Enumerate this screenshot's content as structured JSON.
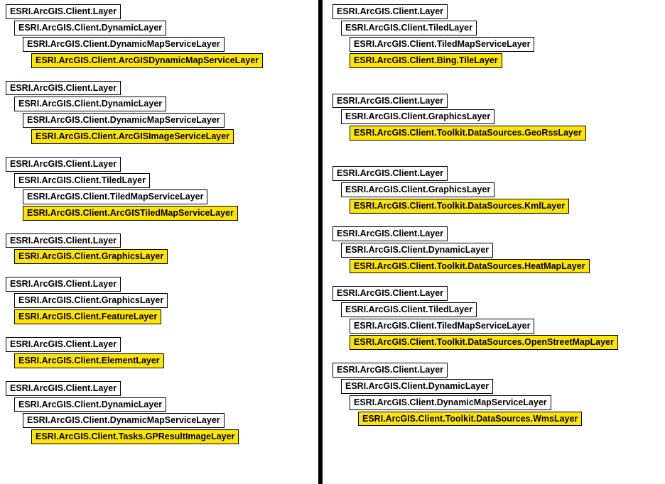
{
  "left": [
    {
      "gap": "normal",
      "nodes": [
        {
          "level": 0,
          "hl": false,
          "text": "ESRI.ArcGIS.Client.Layer"
        },
        {
          "level": 1,
          "hl": false,
          "text": "ESRI.ArcGIS.Client.DynamicLayer"
        },
        {
          "level": 2,
          "hl": false,
          "text": "ESRI.ArcGIS.Client.DynamicMapServiceLayer"
        },
        {
          "level": 3,
          "hl": true,
          "text": "ESRI.ArcGIS.Client.ArcGISDynamicMapServiceLayer"
        }
      ]
    },
    {
      "gap": "normal",
      "nodes": [
        {
          "level": 0,
          "hl": false,
          "text": "ESRI.ArcGIS.Client.Layer"
        },
        {
          "level": 1,
          "hl": false,
          "text": "ESRI.ArcGIS.Client.DynamicLayer"
        },
        {
          "level": 2,
          "hl": false,
          "text": "ESRI.ArcGIS.Client.DynamicMapServiceLayer"
        },
        {
          "level": 3,
          "hl": true,
          "text": "ESRI.ArcGIS.Client.ArcGISImageServiceLayer"
        }
      ]
    },
    {
      "gap": "normal",
      "nodes": [
        {
          "level": 0,
          "hl": false,
          "text": "ESRI.ArcGIS.Client.Layer"
        },
        {
          "level": 1,
          "hl": false,
          "text": "ESRI.ArcGIS.Client.TiledLayer"
        },
        {
          "level": 2,
          "hl": false,
          "text": "ESRI.ArcGIS.Client.TiledMapServiceLayer"
        },
        {
          "level": 2,
          "hl": true,
          "text": "ESRI.ArcGIS.Client.ArcGISTiledMapServiceLayer"
        }
      ]
    },
    {
      "gap": "normal",
      "nodes": [
        {
          "level": 0,
          "hl": false,
          "text": "ESRI.ArcGIS.Client.Layer"
        },
        {
          "level": 1,
          "hl": true,
          "text": "ESRI.ArcGIS.Client.GraphicsLayer"
        }
      ]
    },
    {
      "gap": "normal",
      "nodes": [
        {
          "level": 0,
          "hl": false,
          "text": "ESRI.ArcGIS.Client.Layer"
        },
        {
          "level": 1,
          "hl": false,
          "text": "ESRI.ArcGIS.Client.GraphicsLayer"
        },
        {
          "level": 1,
          "hl": true,
          "text": "ESRI.ArcGIS.Client.FeatureLayer"
        }
      ]
    },
    {
      "gap": "normal",
      "nodes": [
        {
          "level": 0,
          "hl": false,
          "text": "ESRI.ArcGIS.Client.Layer"
        },
        {
          "level": 1,
          "hl": true,
          "text": "ESRI.ArcGIS.Client.ElementLayer"
        }
      ]
    },
    {
      "gap": "normal",
      "nodes": [
        {
          "level": 0,
          "hl": false,
          "text": "ESRI.ArcGIS.Client.Layer"
        },
        {
          "level": 1,
          "hl": false,
          "text": "ESRI.ArcGIS.Client.DynamicLayer"
        },
        {
          "level": 2,
          "hl": false,
          "text": "ESRI.ArcGIS.Client.DynamicMapServiceLayer"
        },
        {
          "level": 3,
          "hl": true,
          "text": "ESRI.ArcGIS.Client.Tasks.GPResultImageLayer"
        }
      ]
    }
  ],
  "right": [
    {
      "gap": "large",
      "nodes": [
        {
          "level": 0,
          "hl": false,
          "text": "ESRI.ArcGIS.Client.Layer"
        },
        {
          "level": 1,
          "hl": false,
          "text": "ESRI.ArcGIS.Client.TiledLayer"
        },
        {
          "level": 2,
          "hl": false,
          "text": "ESRI.ArcGIS.Client.TiledMapServiceLayer"
        },
        {
          "level": 2,
          "hl": true,
          "text": "ESRI.ArcGIS.Client.Bing.TileLayer"
        }
      ]
    },
    {
      "gap": "large",
      "nodes": [
        {
          "level": 0,
          "hl": false,
          "text": "ESRI.ArcGIS.Client.Layer"
        },
        {
          "level": 1,
          "hl": false,
          "text": "ESRI.ArcGIS.Client.GraphicsLayer"
        },
        {
          "level": 2,
          "hl": true,
          "text": "ESRI.ArcGIS.Client.Toolkit.DataSources.GeoRssLayer"
        }
      ]
    },
    {
      "gap": "normal",
      "nodes": [
        {
          "level": 0,
          "hl": false,
          "text": "ESRI.ArcGIS.Client.Layer"
        },
        {
          "level": 1,
          "hl": false,
          "text": "ESRI.ArcGIS.Client.GraphicsLayer"
        },
        {
          "level": 2,
          "hl": true,
          "text": "ESRI.ArcGIS.Client.Toolkit.DataSources.KmlLayer"
        }
      ]
    },
    {
      "gap": "normal",
      "nodes": [
        {
          "level": 0,
          "hl": false,
          "text": "ESRI.ArcGIS.Client.Layer"
        },
        {
          "level": 1,
          "hl": false,
          "text": "ESRI.ArcGIS.Client.DynamicLayer"
        },
        {
          "level": 2,
          "hl": true,
          "text": "ESRI.ArcGIS.Client.Toolkit.DataSources.HeatMapLayer"
        }
      ]
    },
    {
      "gap": "normal",
      "nodes": [
        {
          "level": 0,
          "hl": false,
          "text": "ESRI.ArcGIS.Client.Layer"
        },
        {
          "level": 1,
          "hl": false,
          "text": "ESRI.ArcGIS.Client.TiledLayer"
        },
        {
          "level": 2,
          "hl": false,
          "text": "ESRI.ArcGIS.Client.TiledMapServiceLayer"
        },
        {
          "level": 2,
          "hl": true,
          "text": "ESRI.ArcGIS.Client.Toolkit.DataSources.OpenStreetMapLayer"
        }
      ]
    },
    {
      "gap": "normal",
      "nodes": [
        {
          "level": 0,
          "hl": false,
          "text": "ESRI.ArcGIS.Client.Layer"
        },
        {
          "level": 1,
          "hl": false,
          "text": "ESRI.ArcGIS.Client.DynamicLayer"
        },
        {
          "level": 2,
          "hl": false,
          "text": "ESRI.ArcGIS.Client.DynamicMapServiceLayer"
        },
        {
          "level": 3,
          "hl": true,
          "text": "ESRI.ArcGIS.Client.Toolkit.DataSources.WmsLayer"
        }
      ]
    }
  ]
}
